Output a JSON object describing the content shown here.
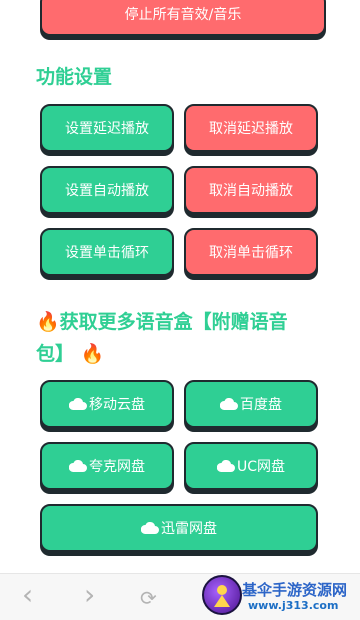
{
  "stop_all": {
    "label": "停止所有音效/音乐"
  },
  "function_settings": {
    "title": "功能设置",
    "buttons": [
      {
        "label": "设置延迟播放"
      },
      {
        "label": "取消延迟播放"
      },
      {
        "label": "设置自动播放"
      },
      {
        "label": "取消自动播放"
      },
      {
        "label": "设置单击循环"
      },
      {
        "label": "取消单击循环"
      }
    ]
  },
  "more_voicebox": {
    "title_line1": "获取更多语音盒【附赠语音",
    "title_line2": "包】",
    "fire_emoji": "🔥",
    "links": [
      {
        "label": "移动云盘"
      },
      {
        "label": "百度盘"
      },
      {
        "label": "夸克网盘"
      },
      {
        "label": "UC网盘"
      },
      {
        "label": "迅雷网盘"
      }
    ]
  },
  "bottom_nav": {
    "back_icon": "‹",
    "forward_icon": "›",
    "refresh_icon": "⟳"
  },
  "watermark": {
    "title": "基伞手游资源网",
    "url": "www.j313.com"
  },
  "colors": {
    "green": "#2fcf94",
    "red": "#ff6b6e",
    "border": "#1f2a2f"
  }
}
